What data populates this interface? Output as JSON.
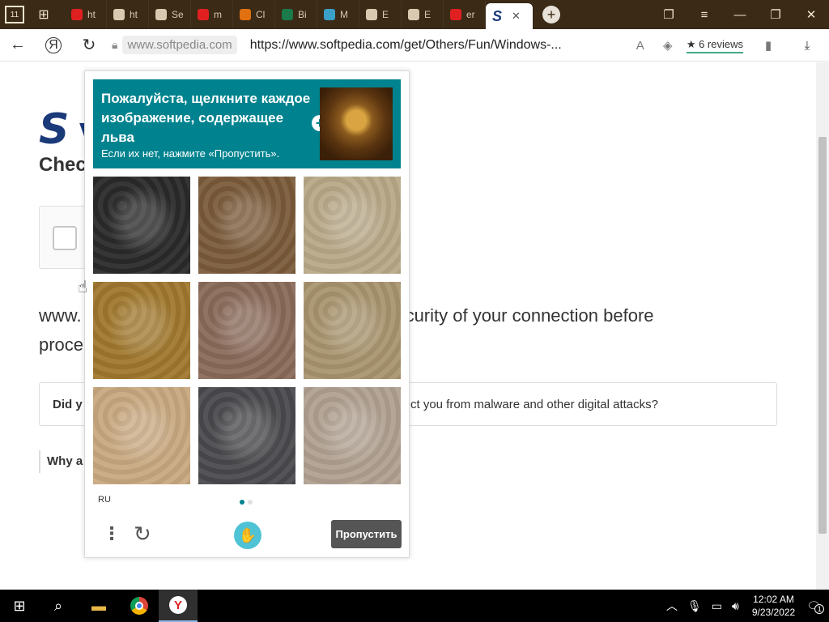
{
  "browser": {
    "tabs": [
      {
        "label": "ht",
        "favicon": "yandex-icon",
        "color": "#e02020"
      },
      {
        "label": "ht",
        "favicon": "document-icon",
        "color": "#d9c9b0"
      },
      {
        "label": "Se",
        "favicon": "gear-icon",
        "color": "#d9c9b0"
      },
      {
        "label": "m",
        "favicon": "yandex-icon",
        "color": "#e02020"
      },
      {
        "label": "Cl",
        "favicon": "download-box-icon",
        "color": "#e07010"
      },
      {
        "label": "Bi",
        "favicon": "chart-icon",
        "color": "#1a7a4a"
      },
      {
        "label": "M",
        "favicon": "m-logo-icon",
        "color": "#3aa0c8"
      },
      {
        "label": "E",
        "favicon": "document-icon",
        "color": "#d9c9b0"
      },
      {
        "label": "E",
        "favicon": "museum-icon",
        "color": "#d9c9b0"
      },
      {
        "label": "er",
        "favicon": "yandex-icon",
        "color": "#e02020"
      }
    ],
    "active_tab": {
      "favicon_text": "S",
      "close": "✕"
    },
    "home_badge": "11",
    "domain": "www.softpedia.com",
    "url": "https://www.softpedia.com/get/Others/Fun/Windows-...",
    "reviews": "★ 6 reviews"
  },
  "page": {
    "logo_s": "S",
    "logo_w": "v",
    "check_title": "Check",
    "body_text_left": "www.",
    "body_text_right": "curity of your connection before",
    "body_text_line2": "proce",
    "did_left": "Did y",
    "did_right": "ct you from malware and other digital attacks?",
    "why": "Why a"
  },
  "captcha": {
    "title": "Пожалуйста, щелкните каждое изображение, содержащее льва",
    "subtitle": "Если их нет, нажмите «Пропустить».",
    "language": "RU",
    "skip_label": "Пропустить",
    "images": [
      {
        "subject": "black dog",
        "bg": "#2a2a2a"
      },
      {
        "subject": "brown horse",
        "bg": "#7a5a3a"
      },
      {
        "subject": "lion",
        "bg": "#b8a888"
      },
      {
        "subject": "lion",
        "bg": "#a0782e"
      },
      {
        "subject": "white horse",
        "bg": "#8a6a5a"
      },
      {
        "subject": "lion",
        "bg": "#a8946e"
      },
      {
        "subject": "puppy",
        "bg": "#c8a880"
      },
      {
        "subject": "black dog",
        "bg": "#4a4a4e"
      },
      {
        "subject": "lioness",
        "bg": "#b0a090"
      }
    ],
    "pages": 2,
    "current_page": 1
  },
  "taskbar": {
    "time": "12:02 AM",
    "date": "9/23/2022",
    "notifications": "1"
  }
}
